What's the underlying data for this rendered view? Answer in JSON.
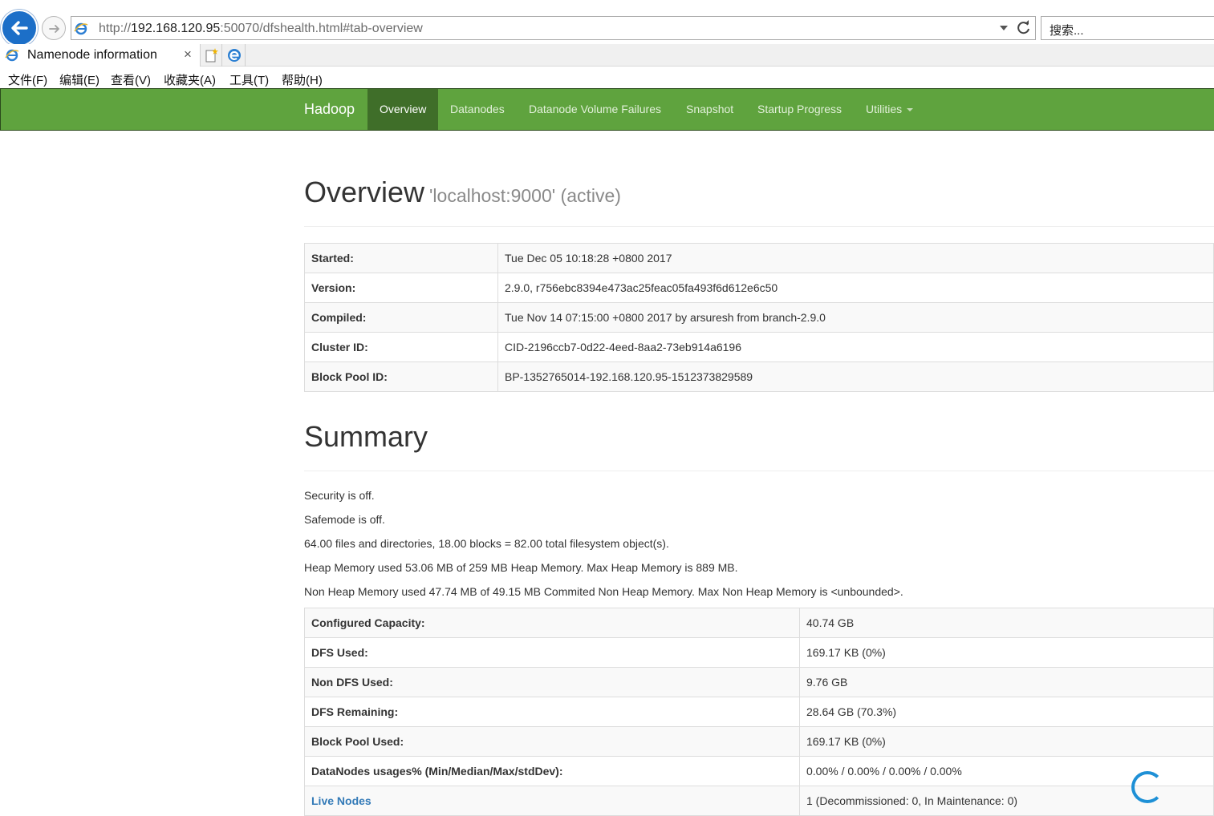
{
  "browser": {
    "url_prefix": "http://",
    "url_host": "192.168.120.95",
    "url_rest": ":50070/dfshealth.html#tab-overview",
    "search_placeholder": "搜索...",
    "tab_title": "Namenode information",
    "tab_close": "×",
    "menu": [
      "文件(F)",
      "编辑(E)",
      "查看(V)",
      "收藏夹(A)",
      "工具(T)",
      "帮助(H)"
    ]
  },
  "navbar": {
    "brand": "Hadoop",
    "links": [
      "Overview",
      "Datanodes",
      "Datanode Volume Failures",
      "Snapshot",
      "Startup Progress",
      "Utilities"
    ],
    "active": "Overview",
    "color": "#5fa33e",
    "active_color": "#3f6e29"
  },
  "overview": {
    "title": "Overview",
    "subtitle": "'localhost:9000' (active)",
    "rows": [
      {
        "key": "Started:",
        "value": "Tue Dec 05 10:18:28 +0800 2017"
      },
      {
        "key": "Version:",
        "value": "2.9.0, r756ebc8394e473ac25feac05fa493f6d612e6c50"
      },
      {
        "key": "Compiled:",
        "value": "Tue Nov 14 07:15:00 +0800 2017 by arsuresh from branch-2.9.0"
      },
      {
        "key": "Cluster ID:",
        "value": "CID-2196ccb7-0d22-4eed-8aa2-73eb914a6196"
      },
      {
        "key": "Block Pool ID:",
        "value": "BP-1352765014-192.168.120.95-1512373829589"
      }
    ]
  },
  "summary": {
    "title": "Summary",
    "lines": [
      "Security is off.",
      "Safemode is off.",
      "64.00 files and directories, 18.00 blocks = 82.00 total filesystem object(s).",
      "Heap Memory used 53.06 MB of 259 MB Heap Memory. Max Heap Memory is 889 MB.",
      "Non Heap Memory used 47.74 MB of 49.15 MB Commited Non Heap Memory. Max Non Heap Memory is <unbounded>."
    ],
    "rows": [
      {
        "key": "Configured Capacity:",
        "value": "40.74 GB"
      },
      {
        "key": "DFS Used:",
        "value": "169.17 KB (0%)"
      },
      {
        "key": "Non DFS Used:",
        "value": "9.76 GB"
      },
      {
        "key": "DFS Remaining:",
        "value": "28.64 GB (70.3%)"
      },
      {
        "key": "Block Pool Used:",
        "value": "169.17 KB (0%)"
      },
      {
        "key": "DataNodes usages% (Min/Median/Max/stdDev):",
        "value": "0.00% / 0.00% / 0.00% / 0.00%"
      },
      {
        "key": "Live Nodes",
        "value": "1 (Decommissioned: 0, In Maintenance: 0)",
        "link": true
      }
    ]
  }
}
